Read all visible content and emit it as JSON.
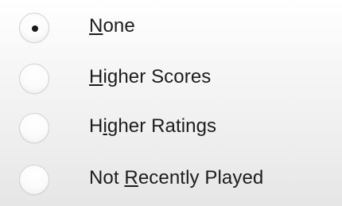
{
  "radio_group": {
    "selected_index": 0,
    "options": [
      {
        "label_pre": "",
        "mnemonic": "N",
        "label_post": "one",
        "checked": true
      },
      {
        "label_pre": "",
        "mnemonic": "H",
        "label_post": "igher Scores",
        "checked": false
      },
      {
        "label_pre": "H",
        "mnemonic": "i",
        "label_post": "gher Ratings",
        "checked": false
      },
      {
        "label_pre": "Not ",
        "mnemonic": "R",
        "label_post": "ecently Played",
        "checked": false
      }
    ]
  }
}
